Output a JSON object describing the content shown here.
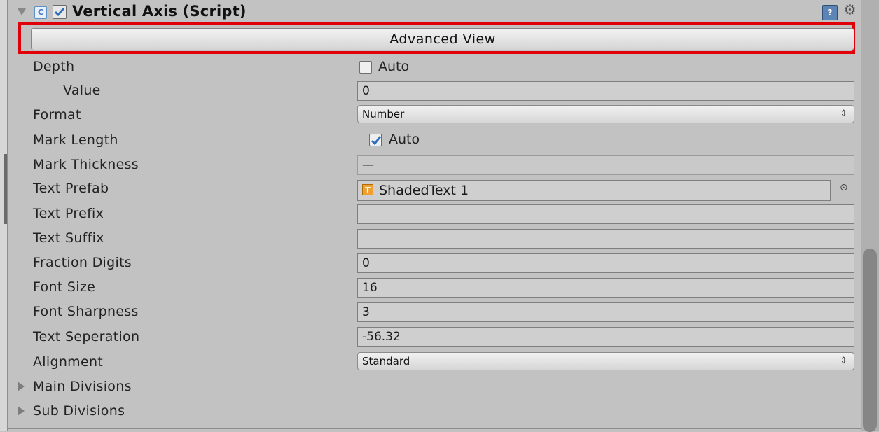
{
  "component": {
    "title": "Vertical Axis (Script)",
    "enabled": true,
    "advanced_view_label": "Advanced View"
  },
  "fields": {
    "depth": {
      "label": "Depth",
      "auto_checked": false,
      "auto_label": "Auto"
    },
    "value": {
      "label": "Value",
      "value": "0"
    },
    "format": {
      "label": "Format",
      "selected": "Number"
    },
    "mark_length": {
      "label": "Mark Length",
      "auto_checked": true,
      "auto_label": "Auto"
    },
    "mark_thickness": {
      "label": "Mark Thickness",
      "value": "—"
    },
    "text_prefab": {
      "label": "Text Prefab",
      "value": "ShadedText 1"
    },
    "text_prefix": {
      "label": "Text Prefix",
      "value": ""
    },
    "text_suffix": {
      "label": "Text Suffix",
      "value": ""
    },
    "fraction_digits": {
      "label": "Fraction Digits",
      "value": "0"
    },
    "font_size": {
      "label": "Font Size",
      "value": "16"
    },
    "font_sharpness": {
      "label": "Font Sharpness",
      "value": "3"
    },
    "text_seperation": {
      "label": "Text Seperation",
      "value": "-56.32"
    },
    "alignment": {
      "label": "Alignment",
      "selected": "Standard"
    }
  },
  "foldouts": {
    "main_divisions": "Main Divisions",
    "sub_divisions": "Sub Divisions"
  },
  "icons": {
    "script": "script-icon",
    "help": "help-icon",
    "settings": "gear-icon",
    "prefab": "text-prefab-icon",
    "picker": "object-picker-icon"
  },
  "colors": {
    "highlight": "#e0000a",
    "panel_bg": "#c2c2c2",
    "checkbox_check": "#2f6dbd"
  }
}
